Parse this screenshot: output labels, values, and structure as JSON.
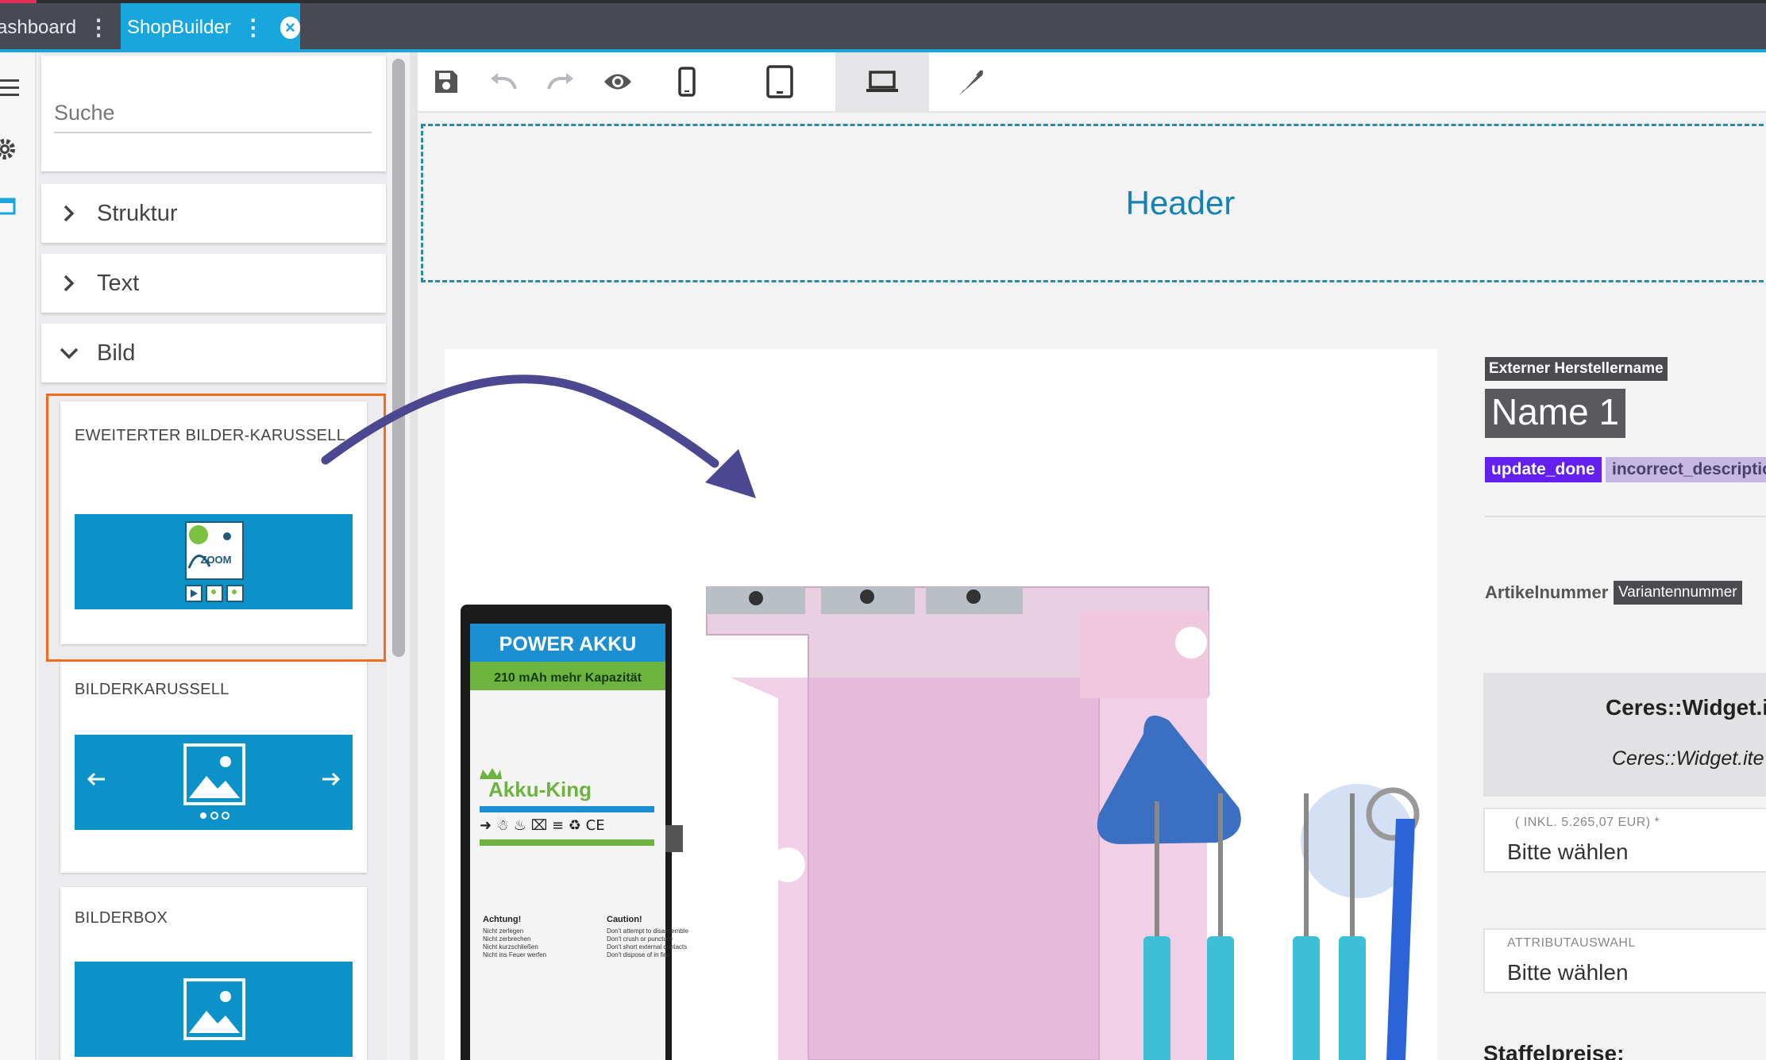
{
  "tabs": [
    {
      "label": "ashboard"
    },
    {
      "label": "ShopBuilder"
    }
  ],
  "sidebar": {
    "search_placeholder": "Suche",
    "categories": [
      {
        "label": "Struktur",
        "expanded": false
      },
      {
        "label": "Text",
        "expanded": false
      },
      {
        "label": "Bild",
        "expanded": true
      }
    ],
    "widgets": [
      {
        "label": "EWEITERTER BILDER-KARUSSELL",
        "thumb_text": "ZOOM"
      },
      {
        "label": "BILDERKARUSSELL"
      },
      {
        "label": "BILDERBOX"
      }
    ]
  },
  "toolbar": {
    "icons": [
      "save-icon",
      "undo-icon",
      "redo-icon",
      "eye-icon",
      "phone-icon",
      "tablet-icon",
      "laptop-icon",
      "feather-icon"
    ]
  },
  "canvas": {
    "header_label": "Header"
  },
  "product_image": {
    "battery_title": "POWER AKKU",
    "battery_subtitle": "210 mAh mehr Kapazität",
    "battery_brand": "Akku-King",
    "warning_de_title": "Achtung!",
    "warning_de_lines": [
      "Nicht zerlegen",
      "Nicht zerbrechen",
      "Nicht kurzschließen",
      "Nicht ins Feuer werfen"
    ],
    "warning_en_title": "Caution!",
    "warning_en_lines": [
      "Don't attempt to disassemble",
      "Don't crush or puncture",
      "Don't short external contacts",
      "Don't dispose of in fire"
    ]
  },
  "product": {
    "manufacturer_tag": "Externer Herstellername",
    "name": "Name 1",
    "badge_update": "update_done",
    "badge_incorrect": "incorrect_descriptio",
    "article_label": "Artikelnummer",
    "variant_label": "Variantennummer",
    "widget_title": "Ceres::Widget.i",
    "widget_sub": "Ceres::Widget.ite",
    "select1_small": "( INKL. 5.265,07 EUR) *",
    "select1_value": "Bitte wählen",
    "select2_small": "ATTRIBUTAUSWAHL",
    "select2_value": "Bitte wählen",
    "staffel_label": "Staffelpreise:"
  },
  "colors": {
    "accent": "#18a6dc",
    "tabbar": "#474a55",
    "highlight_frame": "#f26b21",
    "arrow": "#4b4790",
    "badge_update": "#6320ee"
  }
}
